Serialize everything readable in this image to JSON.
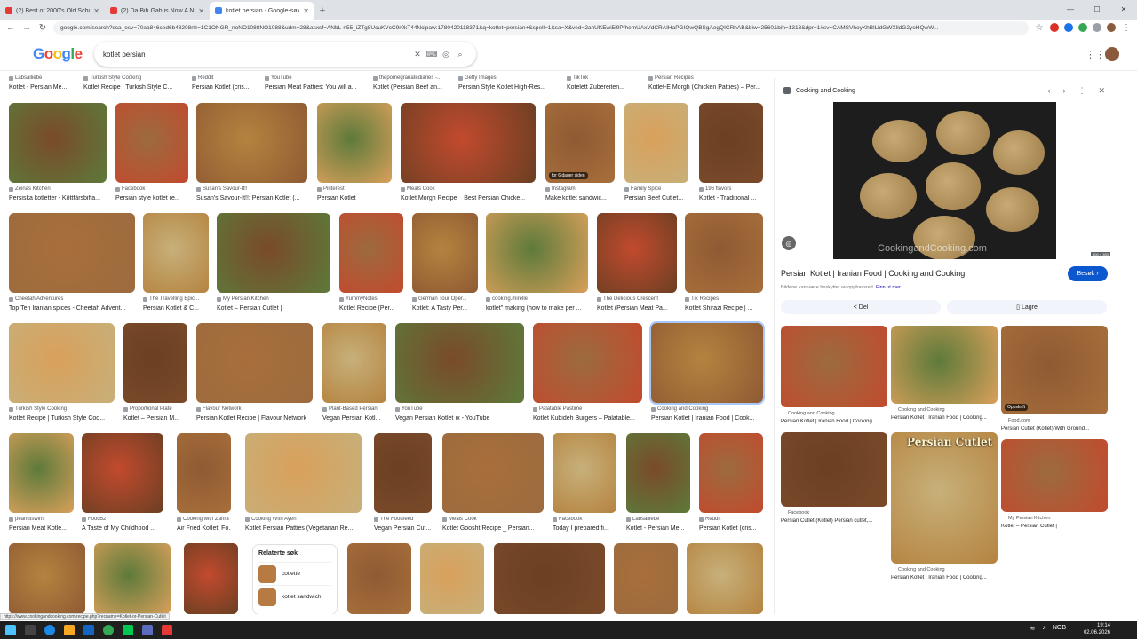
{
  "tabs": [
    {
      "title": "(2) Best of 2000's Old School H",
      "color": "#e53935",
      "active": false
    },
    {
      "title": "(2) Da Bih Gah is Now A Nu",
      "color": "#e53935",
      "active": false
    },
    {
      "title": "kotlet persian - Google-søk",
      "color": "#4285f4",
      "active": true
    }
  ],
  "url": "google.com/search?sca_esv=70aa846ced6b48208rlz=1C1ONGR_noNO1088NO1088&udm=28&asxsf=ANbL-n55_iZTg8UcuKVcC9r0kT44Nclpaw:1780420118371&q=kotlet+persian+&spell=1&sa=X&ved=2ahUKEwi5i9PfhemUAxVdCRAIHaPGIQwQBSgAegQICRhAB&biw=2560&bih=1313&dpr=1#sv=CAMSVhoyKhBlLldGWXlldG2yeHQwW...",
  "logo": "Google",
  "search": {
    "query": "kotlet persian"
  },
  "top_row": [
    {
      "src": "Labsalliebe",
      "cap": "Kotlet - Persian Me..."
    },
    {
      "src": "Turkish Style Cooking",
      "cap": "Kotlet Recipe | Turkish Style C..."
    },
    {
      "src": "Reddit",
      "cap": "Persian Kotlet (cris..."
    },
    {
      "src": "YouTube",
      "cap": "Persian Meat Patties: You will a..."
    },
    {
      "src": "thepomegranatediaries -...",
      "cap": "Kotlet (Persian Beef an..."
    },
    {
      "src": "Getty Images",
      "cap": "Persian Style Kotlet High-Res..."
    },
    {
      "src": "TikTok",
      "cap": "Kotelett Zubereiten..."
    },
    {
      "src": "Persian Recipes",
      "cap": "Kotlet-E Morgh (Chicken Patties) – Per..."
    }
  ],
  "row1": [
    {
      "src": "Zeinas Kitchen",
      "cap": "Persiska kotletter - Köttfärsbiffa..."
    },
    {
      "src": "Facebook",
      "cap": "Persian style kotlet re..."
    },
    {
      "src": "Susan's Savour-It!!",
      "cap": "Susan's Savour-It!!: Persian Kotlet (..."
    },
    {
      "src": "Pinterest",
      "cap": "Persian Kotlet"
    },
    {
      "src": "Meals Cook",
      "cap": "Kotlet Morgh Recipe _ Best Persian Chicke..."
    },
    {
      "src": "Instagram",
      "cap": "Make kotlet sandwic...",
      "badge": "for 6 dager siden"
    },
    {
      "src": "Family Spice",
      "cap": "Persian Beef Cutlet..."
    },
    {
      "src": "196 flavors",
      "cap": "Kotlet - Traditional ..."
    }
  ],
  "row2": [
    {
      "src": "Cheetah Adventures",
      "cap": "Top Ten Iranian spices - Cheetah Advent..."
    },
    {
      "src": "The Travelling Epic...",
      "cap": "Persian Kotlet & C..."
    },
    {
      "src": "My Persian Kitchen",
      "cap": "Kotlet – Persian Cutlet |"
    },
    {
      "src": "YummyNotes",
      "cap": "Kotlet Recipe (Per..."
    },
    {
      "src": "German Tour Oper...",
      "cap": "Kotlet: A Tasty Per..."
    },
    {
      "src": "cooking.mirelle",
      "cap": "kotlet\" making (how to make per ..."
    },
    {
      "src": "The Delicious Crescent",
      "cap": "Kotlet (Persian Meat Pa..."
    },
    {
      "src": "Tik Recipes",
      "cap": "Kotlet Shirazi Recipe | ..."
    }
  ],
  "row3": [
    {
      "src": "Turkish Style Cooking",
      "cap": "Kotlet Recipe | Turkish Style Coo..."
    },
    {
      "src": "Proportional Plate",
      "cap": "Kotlet – Persian M..."
    },
    {
      "src": "Flavour Network",
      "cap": "Persian Kotlet Recipe | Flavour Network"
    },
    {
      "src": "Plant-Based Persian",
      "cap": "Vegan Persian Kotl..."
    },
    {
      "src": "YouTube",
      "cap": "Vegan Persian Kotlet ıx - YouTube"
    },
    {
      "src": "Palatable Pastime",
      "cap": "Kotlet Kubideh Burgers – Palatable..."
    },
    {
      "src": "Cooking and Cooking",
      "cap": "Persian Kotlet | Iranian Food | Cook..."
    }
  ],
  "row4": [
    {
      "src": "peanutswirls",
      "cap": "Persian Meat Kotle..."
    },
    {
      "src": "Food52",
      "cap": "A Taste of My Childhood ..."
    },
    {
      "src": "Cooking with Zahra -",
      "cap": "Air Fried Kotlet: Fo..."
    },
    {
      "src": "Cooking With Ayeh",
      "cap": "Kotlet Persian Patties (Vegetarian Re..."
    },
    {
      "src": "The Foodfeed",
      "cap": "Vegan Persian Cut..."
    },
    {
      "src": "Meals Cook",
      "cap": "Kotlet Goosht Recipe _ Persian..."
    },
    {
      "src": "Facebook",
      "cap": "Today I prepared fi..."
    },
    {
      "src": "Labsalliebe",
      "cap": "Kotlet - Persian Me..."
    },
    {
      "src": "Reddit",
      "cap": "Persian Kotlet (cris..."
    }
  ],
  "related": {
    "title": "Relaterte søk",
    "items": [
      "cotlette",
      "kotlet sandwich"
    ]
  },
  "panel": {
    "source": "Cooking and Cooking",
    "watermark": "CookingandCooking.com",
    "size": "500 × 353",
    "title": "Persian Kotlet | Iranian Food | Cooking and Cooking",
    "copyright": "Bildene kan være beskyttet av opphavsrett.",
    "learn_more": "Finn ut mer",
    "visit": "Besøk",
    "share": "Del",
    "save": "Lagre",
    "related": [
      {
        "src": "Cooking and Cooking",
        "cap": "Persian Kotlet | Iranian Food | Cooking..."
      },
      {
        "src": "Cooking and Cooking",
        "cap": "Persian Kotlet | Iranian Food | Cooking..."
      },
      {
        "src": "Food.com",
        "cap": "Persian Cutlet (Kotlet) With Ground...",
        "badge": "Oppskrift"
      },
      {
        "src": "Facebook",
        "cap": "Persian Cutlet (Kotlet) Persian cutlet,..."
      },
      {
        "src": "Cooking and Cooking",
        "cap": "Persian Kotlet | Iranian Food | Cooking...",
        "overlay": "Persian Cutlet"
      },
      {
        "src": "My Persian Kitchen",
        "cap": "Kotlet – Persian Cutlet |"
      }
    ]
  },
  "status_url": "https://www.cookingandcooking.com/recipe.php?recname=Kotlet-or-Persian-Cutlet",
  "clock": {
    "time": "19:14",
    "date": "02.06.2026"
  },
  "tray_lang": "NOB"
}
